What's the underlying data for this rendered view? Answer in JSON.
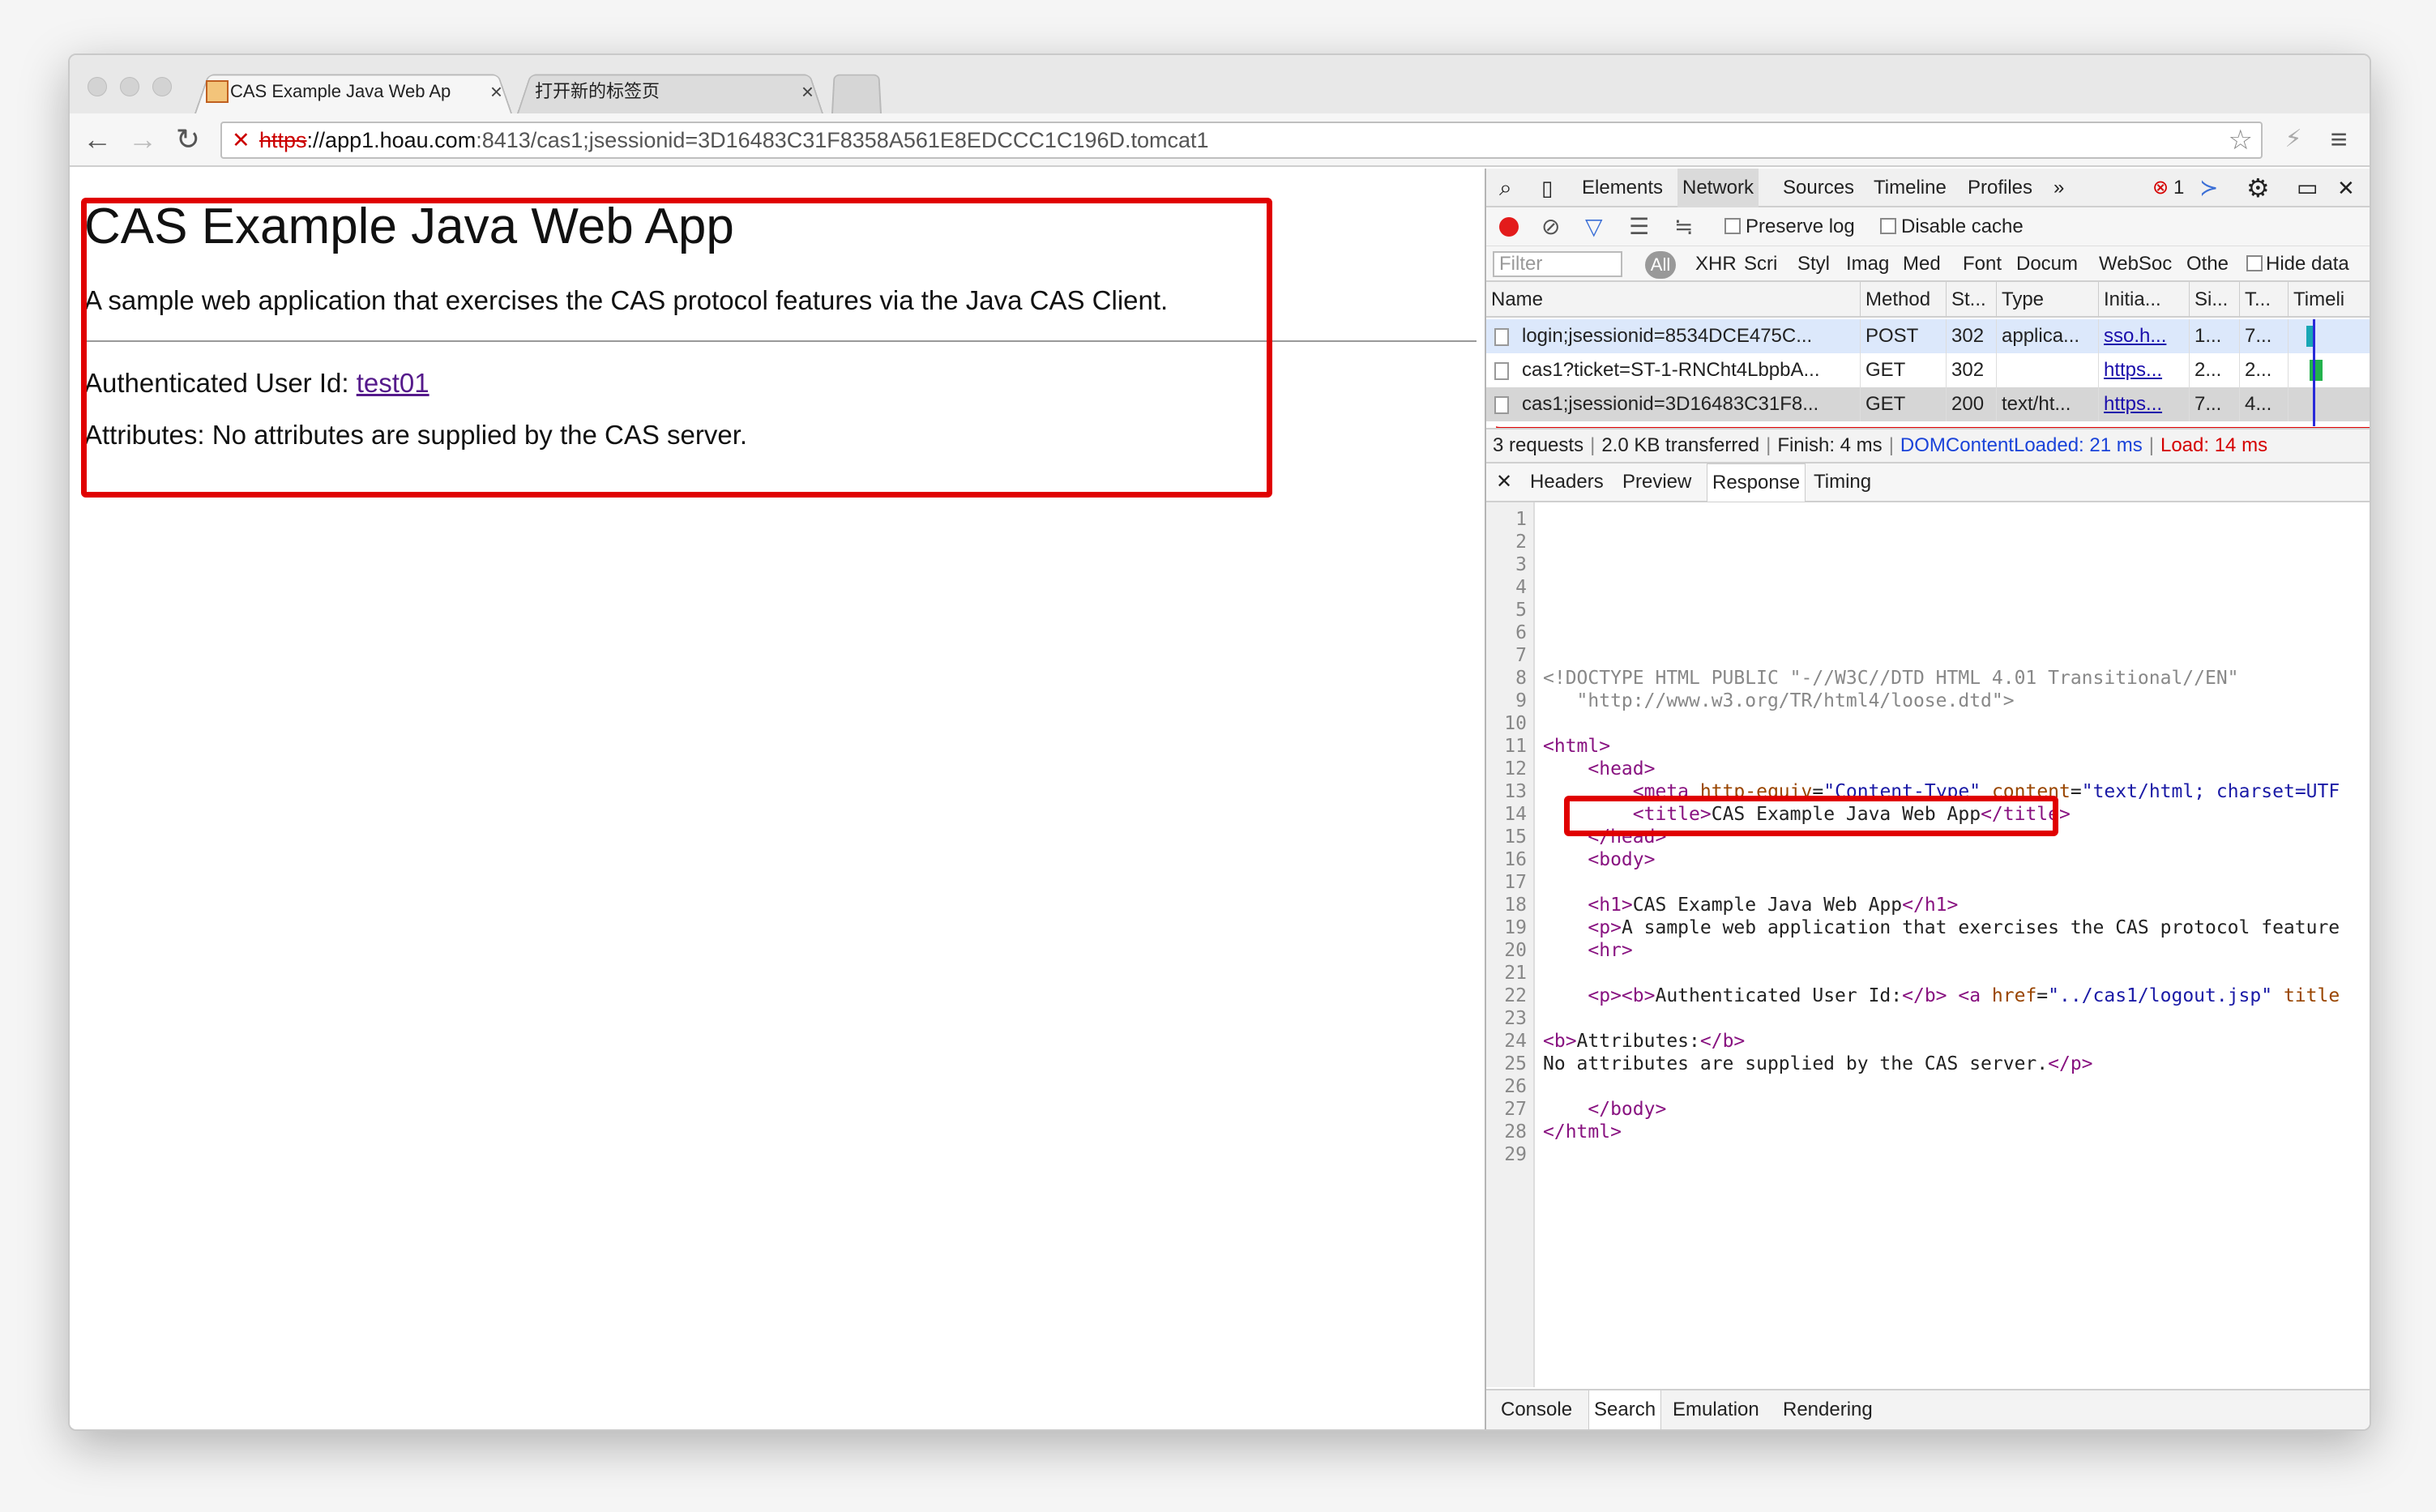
{
  "browser": {
    "tabs": [
      {
        "title": "CAS Example Java Web Ap",
        "close": "×"
      },
      {
        "title": "打开新的标签页",
        "close": "×"
      }
    ],
    "url": {
      "proto": "https",
      "host": "://app1.hoau.com",
      "rest": ":8413/cas1;jsessionid=3D16483C31F8358A561E8EDCCC1C196D.tomcat1"
    }
  },
  "page": {
    "h1": "CAS Example Java Web App",
    "description": "A sample web application that exercises the CAS protocol features via the Java CAS Client.",
    "auth_label": "Authenticated User Id: ",
    "user_id": "test01",
    "attributes": "Attributes: No attributes are supplied by the CAS server."
  },
  "devtools": {
    "panels": [
      "Elements",
      "Network",
      "Sources",
      "Timeline",
      "Profiles",
      "»"
    ],
    "error_count": "1",
    "preserve_log": "Preserve log",
    "disable_cache": "Disable cache",
    "filter_placeholder": "Filter",
    "all": "All",
    "filter_types": [
      "XHR",
      "Scri",
      "Styl",
      "Imag",
      "Med",
      "Font",
      "Docum",
      "WebSoc",
      "Othe"
    ],
    "hide_data": "Hide data",
    "columns": [
      "Name",
      "Method",
      "St...",
      "Type",
      "Initia...",
      "Si...",
      "T...",
      "Timeli"
    ],
    "requests": [
      {
        "name": "login;jsessionid=8534DCE475C...",
        "method": "POST",
        "status": "302",
        "type": "applica...",
        "initiator": "sso.h...",
        "size": "1...",
        "time": "7..."
      },
      {
        "name": "cas1?ticket=ST-1-RNCht4LbpbA...",
        "method": "GET",
        "status": "302",
        "type": "",
        "initiator": "https...",
        "size": "2...",
        "time": "2..."
      },
      {
        "name": "cas1;jsessionid=3D16483C31F8...",
        "method": "GET",
        "status": "200",
        "type": "text/ht...",
        "initiator": "https...",
        "size": "7...",
        "time": "4..."
      }
    ],
    "summary": {
      "requests": "3 requests",
      "transferred": "2.0 KB transferred",
      "finish": "Finish: 4 ms",
      "dcl": "DOMContentLoaded: 21 ms",
      "load": "Load: 14 ms"
    },
    "subtabs": [
      "Headers",
      "Preview",
      "Response",
      "Timing"
    ],
    "code": {
      "doctype1": "<!DOCTYPE HTML PUBLIC \"-//W3C//DTD HTML 4.01 Transitional//EN\"",
      "doctype2": "   \"http://www.w3.org/TR/html4/loose.dtd\">",
      "l11": "<html>",
      "l12": "    <head>",
      "l13a": "        <meta ",
      "l13b": "http-equiv",
      "l13c": "=",
      "l13d": "\"Content-Type\"",
      "l13e": " content",
      "l13f": "=",
      "l13g": "\"text/html; charset=UTF",
      "l14a": "        <title>",
      "l14b": "CAS Example Java Web App",
      "l14c": "</title>",
      "l15": "    </head>",
      "l16": "    <body>",
      "l18a": "    <h1>",
      "l18b": "CAS Example Java Web App",
      "l18c": "</h1>",
      "l19a": "    <p>",
      "l19b": "A sample web application that exercises the CAS protocol feature",
      "l20": "    <hr>",
      "l22a": "    <p><b>",
      "l22b": "Authenticated User Id:",
      "l22c": "</b> <a ",
      "l22d": "href",
      "l22e": "=",
      "l22f": "\"../cas1/logout.jsp\"",
      "l22g": " title",
      "l24a": "<b>",
      "l24b": "Attributes:",
      "l24c": "</b>",
      "l25a": "No attributes are supplied by the CAS server.",
      "l25b": "</p>",
      "l27": "    </body>",
      "l28": "</html>"
    },
    "drawer": [
      "Console",
      "Search",
      "Emulation",
      "Rendering"
    ]
  },
  "colors": {
    "highlight_box": "#e00000",
    "link": "#551a8b",
    "dcl": "#1a43d9",
    "load": "#d50000"
  }
}
